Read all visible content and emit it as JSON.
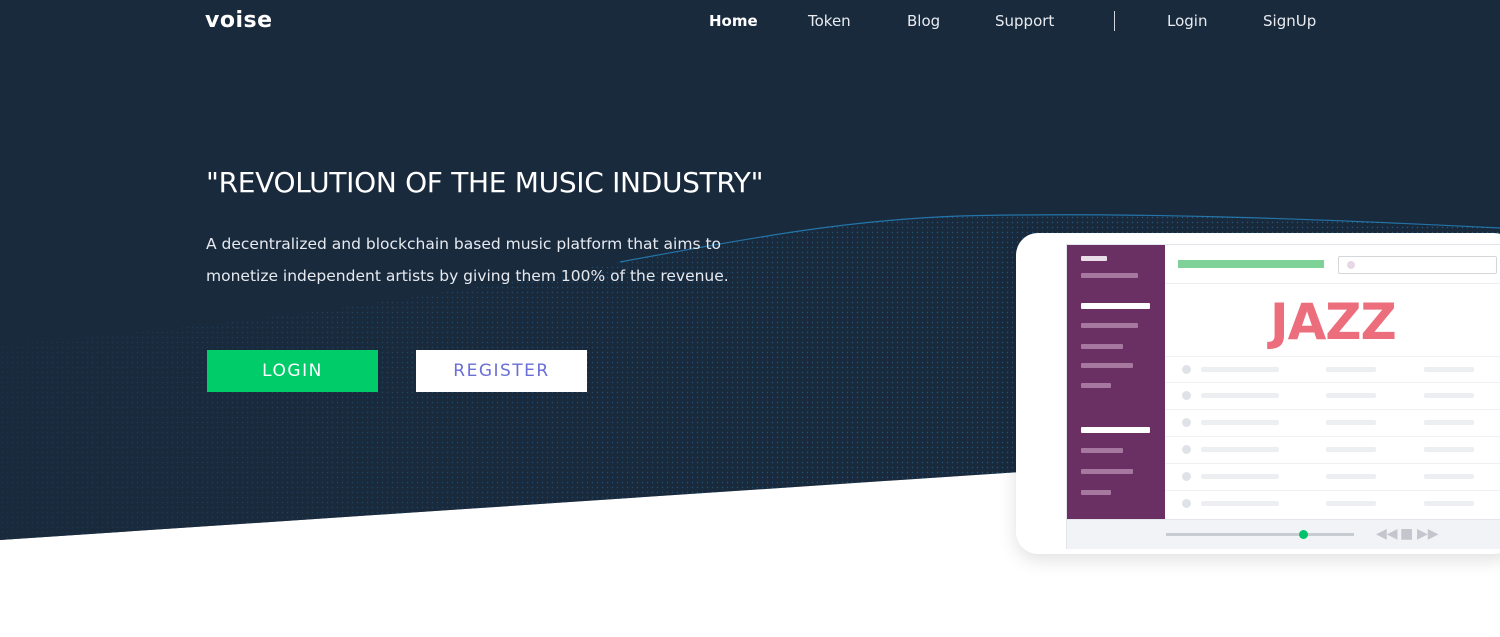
{
  "brand": {
    "logo": "voise"
  },
  "nav": {
    "links": [
      "Home",
      "Token",
      "Blog",
      "Support"
    ],
    "auth": [
      "Login",
      "SignUp"
    ]
  },
  "hero": {
    "headline": "\"REVOLUTION OF THE MUSIC INDUSTRY\"",
    "subheadline": "A decentralized and blockchain based music platform that aims to monetize independent artists by giving them 100% of the revenue.",
    "login_button": "LOGIN",
    "register_button": "REGISTER"
  },
  "mockup": {
    "genre_title": "JAZZ",
    "player_progress": 0.73
  },
  "colors": {
    "hero_background": "#1a2a3d",
    "wave_accent": "#1d8fd9",
    "login_button": "#00cc6a",
    "register_text": "#6a6fd6",
    "sidebar": "#6a2f63",
    "jazz_text": "#ec6d7c"
  },
  "icons": {
    "prev": "rewind-icon",
    "stop": "stop-icon",
    "next": "fast-forward-icon"
  }
}
